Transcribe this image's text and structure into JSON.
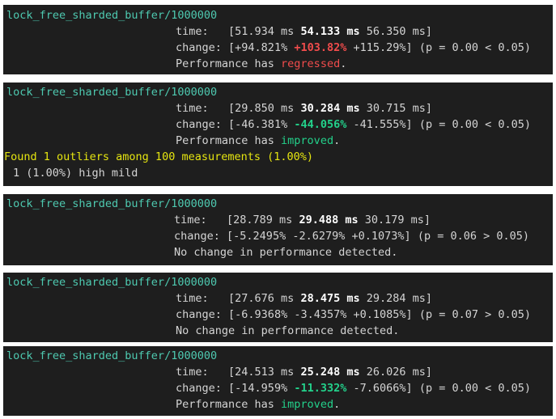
{
  "results": [
    {
      "bench": "lock_free_sharded_buffer/1000000",
      "time_label": "time:",
      "time_low": "51.934 ms",
      "time_mid": "54.133 ms",
      "time_high": "56.350 ms",
      "change_label": "change:",
      "change_low": "+94.821%",
      "change_mid": "+103.82%",
      "change_high": "+115.29%",
      "p_text": "(p = 0.00 < 0.05)",
      "verdict_prefix": "Performance has ",
      "verdict_word": "regressed",
      "verdict_suffix": "."
    },
    {
      "bench": "lock_free_sharded_buffer/1000000",
      "time_label": "time:",
      "time_low": "29.850 ms",
      "time_mid": "30.284 ms",
      "time_high": "30.715 ms",
      "change_label": "change:",
      "change_low": "-46.381%",
      "change_mid": "-44.056%",
      "change_high": "-41.555%",
      "p_text": "(p = 0.00 < 0.05)",
      "verdict_prefix": "Performance has ",
      "verdict_word": "improved",
      "verdict_suffix": ".",
      "outliers": "Found 1 outliers among 100 measurements (1.00%)",
      "outlier_detail": "1 (1.00%) high mild"
    },
    {
      "bench": "lock_free_sharded_buffer/1000000",
      "time_label": "time:",
      "time_low": "28.789 ms",
      "time_mid": "29.488 ms",
      "time_high": "30.179 ms",
      "change_label": "change:",
      "change_low": "-5.2495%",
      "change_mid": "-2.6279%",
      "change_high": "+0.1073%",
      "p_text": "(p = 0.06 > 0.05)",
      "verdict": "No change in performance detected."
    },
    {
      "bench": "lock_free_sharded_buffer/1000000",
      "time_label": "time:",
      "time_low": "27.676 ms",
      "time_mid": "28.475 ms",
      "time_high": "29.284 ms",
      "change_label": "change:",
      "change_low": "-6.9368%",
      "change_mid": "-3.4357%",
      "change_high": "+0.1085%",
      "p_text": "(p = 0.07 > 0.05)",
      "verdict": "No change in performance detected."
    },
    {
      "bench": "lock_free_sharded_buffer/1000000",
      "time_label": "time:",
      "time_low": "24.513 ms",
      "time_mid": "25.248 ms",
      "time_high": "26.026 ms",
      "change_label": "change:",
      "change_low": "-14.959%",
      "change_mid": "-11.332%",
      "change_high": "-7.6066%",
      "p_text": "(p = 0.00 < 0.05)",
      "verdict_prefix": "Performance has ",
      "verdict_word": "improved",
      "verdict_suffix": "."
    }
  ]
}
